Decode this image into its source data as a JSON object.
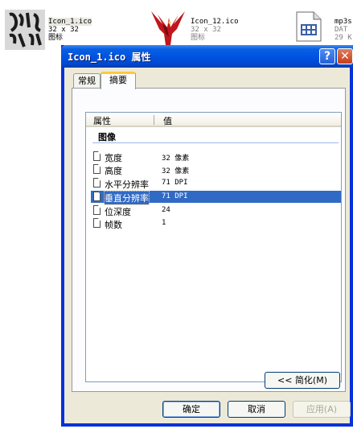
{
  "background_files": [
    {
      "name": "Icon_1.ico",
      "dims": "32 x 32",
      "type": "图标"
    },
    {
      "name": "Icon_12.ico",
      "dims": "32 x 32",
      "type": "图标"
    },
    {
      "name": "mp3s",
      "dims": "DAT",
      "type": "29 K"
    }
  ],
  "dialog": {
    "title": "Icon_1.ico 属性",
    "help_icon": "?",
    "close_icon": "✕",
    "tabs": [
      "常规",
      "摘要"
    ],
    "active_tab": "摘要",
    "columns": {
      "property": "属性",
      "value": "值"
    },
    "group": "图像",
    "rows": [
      {
        "name": "宽度",
        "value": "32 像素",
        "selected": false
      },
      {
        "name": "高度",
        "value": "32 像素",
        "selected": false
      },
      {
        "name": "水平分辨率",
        "value": "71 DPI",
        "selected": false
      },
      {
        "name": "垂直分辨率",
        "value": "71 DPI",
        "selected": true
      },
      {
        "name": "位深度",
        "value": "24",
        "selected": false
      },
      {
        "name": "帧数",
        "value": "1",
        "selected": false
      }
    ],
    "simplify_button": "<< 简化(M)",
    "ok_button": "确定",
    "cancel_button": "取消",
    "apply_button": "应用(A)"
  },
  "colors": {
    "titlebar": "#0054e3",
    "dialog_bg": "#ece9d8",
    "selection": "#316ac5",
    "tab_highlight": "#ffc83c",
    "close_red": "#c4401b"
  }
}
